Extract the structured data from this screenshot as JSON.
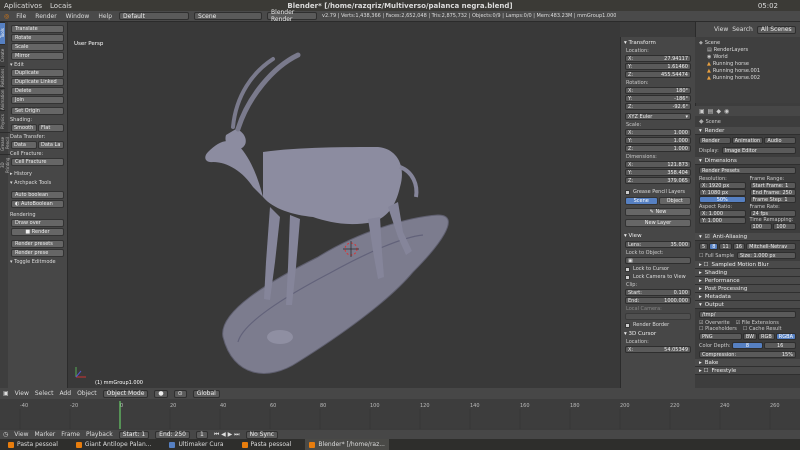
{
  "system_bar": {
    "apps_label": "Aplicativos",
    "places_label": "Locais",
    "window_title": "Blender* [/home/razqriz/Multiverso/palanca negra.blend]",
    "clock": "05:02"
  },
  "menubar": {
    "items": [
      "File",
      "Render",
      "Window",
      "Help"
    ],
    "layout": "Default",
    "scene": "Scene",
    "engine": "Blender Render",
    "stats": "v2.79 | Verts:1,438,366 | Faces:2,652,048 | Tris:2,875,732 | Objects:0/9 | Lamps:0/0 | Mem:483.23M | mmGroup1.000"
  },
  "toolshelf": {
    "tabs": [
      "Tools",
      "Create",
      "Relations",
      "Animation",
      "Physics",
      "Grease Pencil",
      "3D Printing"
    ],
    "transform_buttons": [
      "Translate",
      "Rotate",
      "Scale",
      "Mirror"
    ],
    "edit_header": "Edit",
    "edit_buttons": [
      "Duplicate",
      "Duplicate Linked",
      "Delete",
      "Join"
    ],
    "set_origin": "Set Origin",
    "shading_label": "Shading:",
    "shading_buttons": [
      "Smooth",
      "Flat"
    ],
    "data_transfer_label": "Data Transfer:",
    "data_transfer_buttons": [
      "Data",
      "Data La"
    ],
    "cell_fracture_label": "Cell Fracture:",
    "cell_fracture_button": "Cell Fracture",
    "history_label": "History",
    "archpack_label": "Archpack Tools",
    "auto_boolean": "Auto boolean",
    "autoboolean": "AutoBoolean",
    "rendering_label": "Rendering",
    "draw_over": "Draw over",
    "render_button": "Render",
    "render_presets": "Render presets",
    "render_preset_btn": "Render prese",
    "toggle_editmode": "Toggle Editmode"
  },
  "viewport": {
    "title": "User Persp",
    "object_label": "(1) mmGroup1.000"
  },
  "npanel": {
    "transform_header": "Transform",
    "location_label": "Location:",
    "location": [
      {
        "axis": "X:",
        "value": "27.94117"
      },
      {
        "axis": "Y:",
        "value": "1.61460"
      },
      {
        "axis": "Z:",
        "value": "455.54474"
      }
    ],
    "rotation_label": "Rotation:",
    "rotation": [
      {
        "axis": "X:",
        "value": "180°"
      },
      {
        "axis": "Y:",
        "value": "-186°"
      },
      {
        "axis": "Z:",
        "value": "-92.6°"
      }
    ],
    "rotation_mode": "XYZ Euler",
    "scale_label": "Scale:",
    "scale": [
      {
        "axis": "X:",
        "value": "1.000"
      },
      {
        "axis": "Y:",
        "value": "1.000"
      },
      {
        "axis": "Z:",
        "value": "1.000"
      }
    ],
    "dimensions_label": "Dimensions:",
    "dimensions": [
      {
        "axis": "X:",
        "value": "121.873"
      },
      {
        "axis": "Y:",
        "value": "358.404"
      },
      {
        "axis": "Z:",
        "value": "379.065"
      }
    ],
    "grease_pencil_label": "Grease Pencil Layers",
    "scene_btn": "Scene",
    "object_btn": "Object",
    "new_btn": "New",
    "new_layer_btn": "New Layer",
    "view_header": "View",
    "lens_label": "Lens:",
    "lens_value": "35.000",
    "lock_object_label": "Lock to Object:",
    "lock_cursor": "Lock to Cursor",
    "lock_camera": "Lock Camera to View",
    "clip_label": "Clip:",
    "clip_start_label": "Start:",
    "clip_start": "0.100",
    "clip_end_label": "End:",
    "clip_end": "1000.000",
    "local_camera": "Local Camera:",
    "render_border": "Render Border",
    "cursor_header": "3D Cursor",
    "cursor_location": "Location:",
    "cursor_x": "54.05349"
  },
  "outliner": {
    "tabs": [
      "View",
      "Search",
      "All Scenes"
    ],
    "items": [
      "Scene",
      "RenderLayers",
      "World",
      "Running horse",
      "Running horse.001",
      "Running horse.002"
    ]
  },
  "properties": {
    "scene_label": "Scene",
    "render_header": "Render",
    "render_btn": "Render",
    "animation_btn": "Animation",
    "audio_btn": "Audio",
    "display_label": "Display:",
    "display_value": "Image Editor",
    "dimensions_header": "Dimensions",
    "render_presets": "Render Presets",
    "resolution_label": "Resolution:",
    "res_x": "1920 px",
    "res_y": "1080 px",
    "res_pct": "50%",
    "frame_range_label": "Frame Range:",
    "frame_start": "Start Frame: 1",
    "frame_end": "End Frame: 250",
    "frame_step": "Frame Step: 1",
    "aspect_label": "Aspect Ratio:",
    "aspect_x": "1.000",
    "aspect_y": "1.000",
    "frame_rate_label": "Frame Rate:",
    "frame_rate": "24 fps",
    "time_remap_label": "Time Remapping:",
    "remap_old": "100",
    "remap_new": "100",
    "border_label": "Bord",
    "crop_label": "Crop",
    "aa_header": "Anti-Aliasing",
    "aa_samples": [
      "5",
      "8",
      "11",
      "16"
    ],
    "aa_filter": "Mitchell-Netrav",
    "full_sample": "Full Sample",
    "aa_size": "Size: 1.000 px",
    "motion_blur": "Sampled Motion Blur",
    "shading": "Shading",
    "performance": "Performance",
    "post_processing": "Post Processing",
    "metadata": "Metadata",
    "output": "Output",
    "output_path": "/tmp/",
    "overwrite": "Overwrite",
    "file_extensions": "File Extensions",
    "placeholders": "Placeholders",
    "cache_result": "Cache Result",
    "format": "PNG",
    "color_modes": [
      "BW",
      "RGB",
      "RGBA"
    ],
    "color_depth_label": "Color Depth:",
    "depth_8": "8",
    "depth_16": "16",
    "compression": "Compression:",
    "compression_value": "15%",
    "bake": "Bake",
    "freestyle": "Freestyle"
  },
  "viewport_header": {
    "menus": [
      "View",
      "Select",
      "Add",
      "Object"
    ],
    "mode": "Object Mode",
    "orientation": "Global"
  },
  "timeline": {
    "ticks": [
      "-40",
      "-20",
      "0",
      "20",
      "40",
      "60",
      "80",
      "100",
      "120",
      "140",
      "160",
      "180",
      "200",
      "220",
      "240",
      "260"
    ],
    "footer_menus": [
      "View",
      "Marker",
      "Frame",
      "Playback"
    ],
    "start": "Start:",
    "start_value": "1",
    "end": "End:",
    "end_value": "250",
    "current": "1",
    "sync": "No Sync"
  },
  "taskbar": {
    "items": [
      "Pasta pessoal",
      "Giant Antilope Palan...",
      "Ultimaker Cura",
      "Pasta pessoal",
      "Blender* [/home/raz..."
    ]
  }
}
